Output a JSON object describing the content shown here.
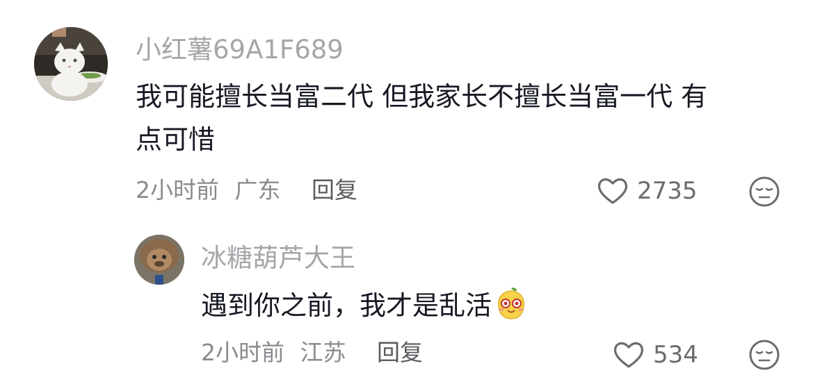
{
  "comments": [
    {
      "username": "小红薯69A1F689",
      "text_line1": "我可能擅长当富二代 但我家长不擅长当富一代 有",
      "text_line2": "点可惜",
      "time": "2小时前",
      "location": "广东",
      "reply_label": "回复",
      "likes": "2735",
      "avatar": "cat-at-dinner-table-avatar"
    },
    {
      "username": "冰糖葫芦大王",
      "text": "遇到你之前，我才是乱活",
      "emoji": "yellow-blob-emoji",
      "time": "2小时前",
      "location": "江苏",
      "reply_label": "回复",
      "likes": "534",
      "avatar": "monkey-avatar"
    }
  ],
  "colors": {
    "username": "#a5a5aa",
    "text": "#161823",
    "meta": "#8a8a8f"
  }
}
